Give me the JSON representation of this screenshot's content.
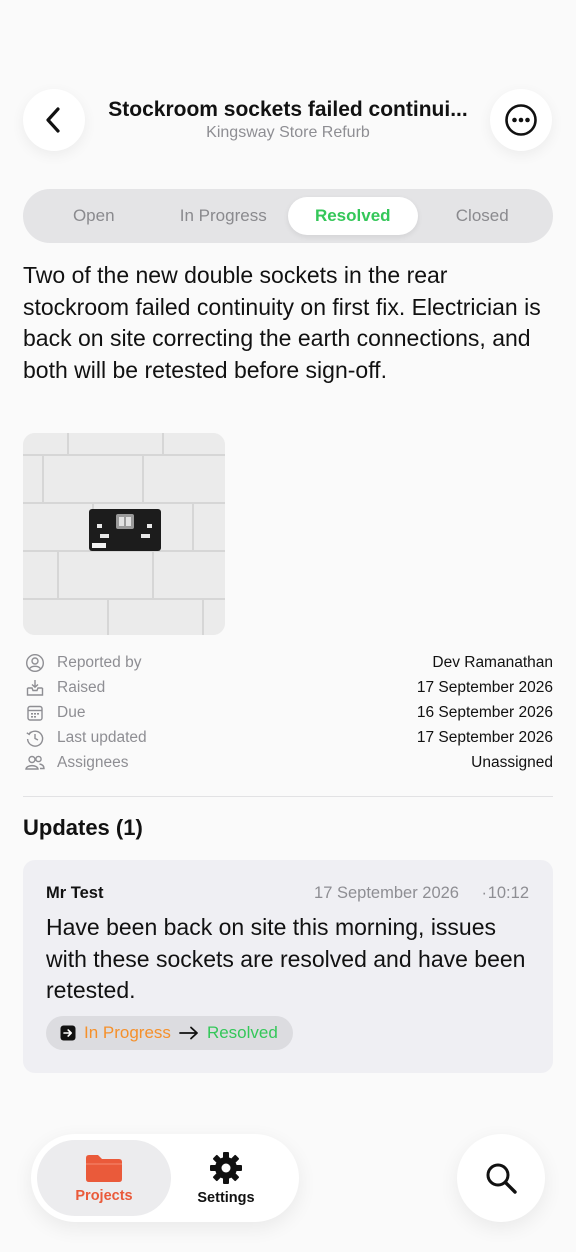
{
  "header": {
    "title": "Stockroom sockets failed continui...",
    "subtitle": "Kingsway Store Refurb",
    "back_icon": "chevron-left-icon",
    "more_icon": "ellipsis-circle-icon"
  },
  "status_tabs": [
    {
      "label": "Open",
      "active": false
    },
    {
      "label": "In Progress",
      "active": false
    },
    {
      "label": "Resolved",
      "active": true
    },
    {
      "label": "Closed",
      "active": false
    }
  ],
  "description": "Two of the new double sockets in the rear stockroom failed continuity on first fix. Electrician is back on site correcting the earth connections, and both will be retested before sign-off.",
  "meta": [
    {
      "icon": "person-circle-icon",
      "label": "Reported by",
      "value": "Dev Ramanathan"
    },
    {
      "icon": "tray-in-icon",
      "label": "Raised",
      "value": "17 September 2026"
    },
    {
      "icon": "calendar-icon",
      "label": "Due",
      "value": "16 September 2026"
    },
    {
      "icon": "history-icon",
      "label": "Last updated",
      "value": "17 September 2026"
    },
    {
      "icon": "people-icon",
      "label": "Assignees",
      "value": "Unassigned"
    }
  ],
  "updates": {
    "heading": "Updates (1)",
    "items": [
      {
        "author": "Mr Test",
        "date": "17 September 2026",
        "separator": "·",
        "time": "10:12",
        "text": "Have been back on site this morning, issues with these sockets are resolved and have been retested.",
        "from_status": "In Progress",
        "to_status": "Resolved"
      }
    ]
  },
  "tabbar": {
    "projects_label": "Projects",
    "settings_label": "Settings"
  },
  "colors": {
    "resolved": "#34c759",
    "in_progress": "#f5902b",
    "projects_accent": "#ea5a3a"
  }
}
